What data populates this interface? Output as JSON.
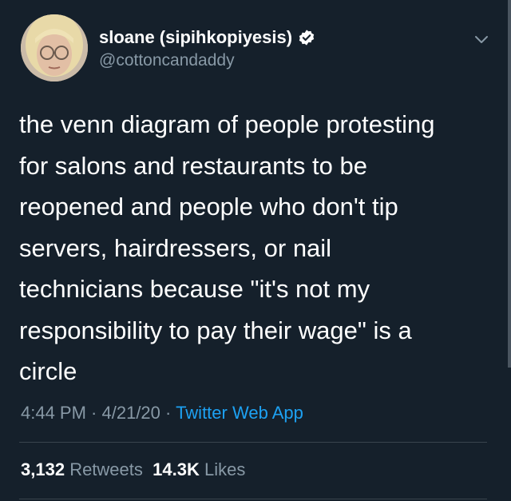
{
  "user": {
    "display_name": "sloane (sipihkopiyesis)",
    "handle": "@cottoncandaddy",
    "verified": true
  },
  "tweet": {
    "text": "the venn diagram of people protesting\nfor salons and restaurants to be\nreopened and people who don't tip\nservers, hairdressers, or nail\ntechnicians because \"it's not my\nresponsibility to pay their wage\" is a\ncircle"
  },
  "meta": {
    "time": "4:44 PM",
    "sep1": " · ",
    "date": "4/21/20",
    "sep2": " · ",
    "source": "Twitter Web App"
  },
  "stats": {
    "retweets_count": "3,132",
    "retweets_label": "Retweets",
    "likes_count": "14.3K",
    "likes_label": "Likes"
  },
  "icons": {
    "verified": "verified-badge-icon",
    "menu": "chevron-down-icon"
  },
  "colors": {
    "background": "#15202b",
    "secondary_text": "#8899a6",
    "link": "#1da1f2",
    "divider": "#38444d"
  }
}
